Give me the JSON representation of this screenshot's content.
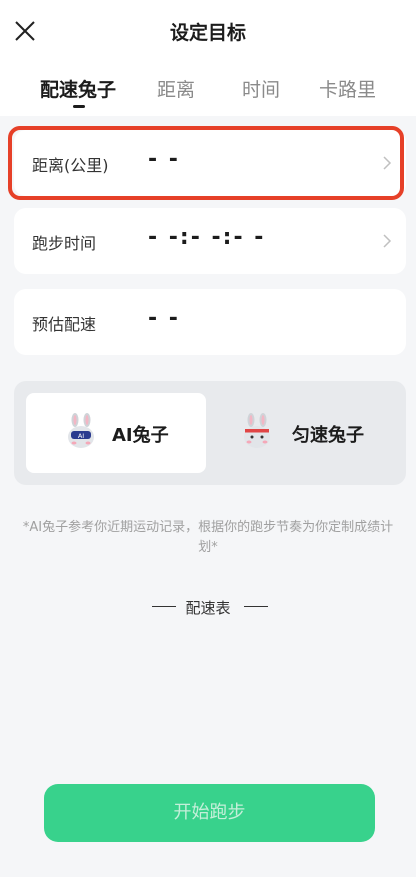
{
  "header": {
    "title": "设定目标"
  },
  "tabs": [
    {
      "label": "配速兔子",
      "active": true
    },
    {
      "label": "距离",
      "active": false
    },
    {
      "label": "时间",
      "active": false
    },
    {
      "label": "卡路里",
      "active": false
    }
  ],
  "fields": [
    {
      "label": "距离(公里)",
      "value": "- -"
    },
    {
      "label": "跑步时间",
      "value": "- -:- -:- -"
    },
    {
      "label": "预估配速",
      "value": "- -"
    }
  ],
  "modes": [
    {
      "label": "AI兔子",
      "selected": true,
      "badge": "AI"
    },
    {
      "label": "匀速兔子",
      "selected": false
    }
  ],
  "note": "*AI兔子参考你近期运动记录，根据你的跑步节奏为你定制成绩计划*",
  "pace_table_title": "配速表",
  "start_button": "开始跑步",
  "colors": {
    "accent": "#38d28c",
    "highlight": "#e64028"
  }
}
